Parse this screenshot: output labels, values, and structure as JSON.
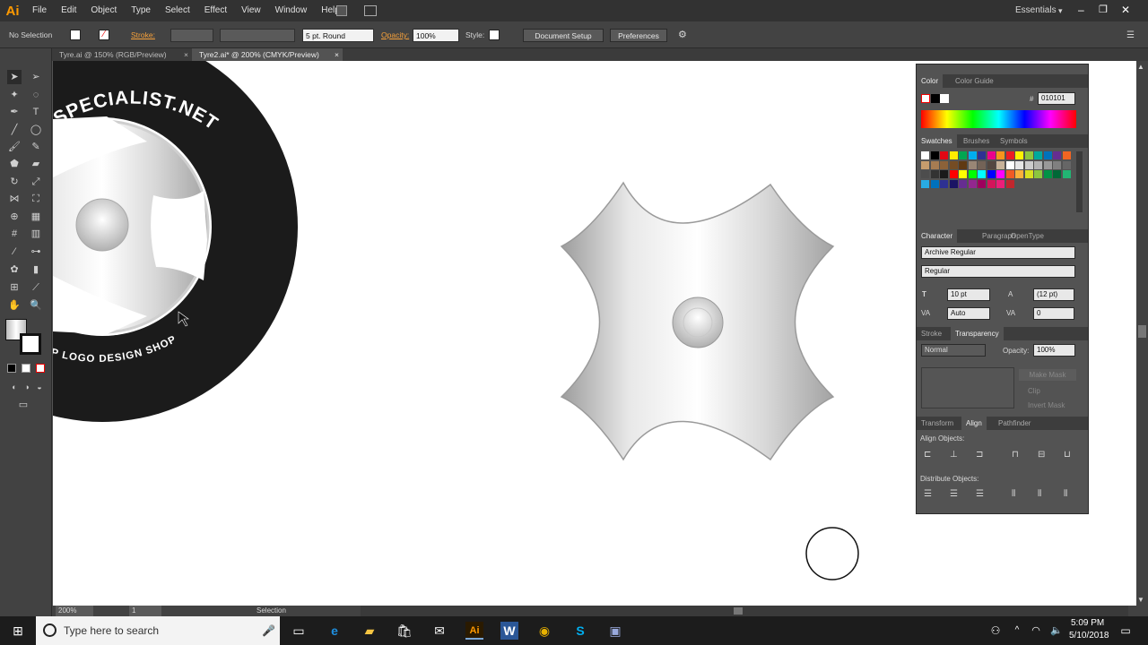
{
  "app": {
    "logo": "Ai"
  },
  "menu": [
    "File",
    "Edit",
    "Object",
    "Type",
    "Select",
    "Effect",
    "View",
    "Window",
    "Help"
  ],
  "workspace": "Essentials",
  "control": {
    "selection": "No Selection",
    "stroke_label": "Stroke:",
    "brush": "5 pt. Round",
    "opacity_label": "Opacity:",
    "opacity": "100%",
    "style_label": "Style:",
    "document_setup": "Document Setup",
    "preferences": "Preferences"
  },
  "tabs": [
    {
      "label": "Tyre.ai @ 150% (RGB/Preview)"
    },
    {
      "label": "Tyre2.ai* @ 200% (CMYK/Preview)"
    }
  ],
  "artwork": {
    "top_text": "SPECIALIST.NET",
    "bottom_text": "OP LOGO DESIGN SHOP"
  },
  "color_panel": {
    "tabs": [
      "Color",
      "Color Guide"
    ],
    "hex": "010101"
  },
  "swatches_panel": {
    "tabs": [
      "Swatches",
      "Brushes",
      "Symbols"
    ]
  },
  "swatch_colors": [
    "#ffffff",
    "#000000",
    "#e30613",
    "#ffed00",
    "#00a651",
    "#00aeef",
    "#2e3192",
    "#ec008c",
    "#f7941d",
    "#ed1c24",
    "#fff200",
    "#8dc63f",
    "#00a99d",
    "#0072bc",
    "#662d91",
    "#f26522",
    "#c69c6d",
    "#a67c52",
    "#8c6239",
    "#754c24",
    "#603913",
    "#998675",
    "#736357",
    "#534741",
    "#c7b299",
    "#ffffff",
    "#e6e6e6",
    "#cccccc",
    "#b3b3b3",
    "#999999",
    "#808080",
    "#666666",
    "#4d4d4d",
    "#333333",
    "#1a1a1a",
    "#ff0000",
    "#ffff00",
    "#00ff00",
    "#00ffff",
    "#0000ff",
    "#ff00ff",
    "#f15a24",
    "#fbb03b",
    "#d9e021",
    "#8cc63f",
    "#009245",
    "#006837",
    "#22b573",
    "#29abe2",
    "#0071bc",
    "#2e3192",
    "#1b1464",
    "#662d91",
    "#93278f",
    "#9e005d",
    "#d4145a",
    "#ed1e79",
    "#c1272d"
  ],
  "character_panel": {
    "tabs": [
      "Character",
      "Paragraph",
      "OpenType"
    ],
    "font": "Archive Regular",
    "style": "Regular",
    "size": "10 pt",
    "leading": "(12 pt)",
    "kerning": "Auto",
    "tracking": "0"
  },
  "transparency_panel": {
    "tabs": [
      "Stroke",
      "Transparency"
    ],
    "mode": "Normal",
    "opacity_label": "Opacity:",
    "opacity": "100%",
    "make_mask": "Make Mask",
    "clip": "Clip",
    "invert_mask": "Invert Mask"
  },
  "align_panel": {
    "tabs": [
      "Transform",
      "Align",
      "Pathfinder"
    ],
    "align_objects": "Align Objects:",
    "distribute_objects": "Distribute Objects:"
  },
  "status": {
    "zoom": "200%",
    "page": "1",
    "tool": "Selection"
  },
  "taskbar": {
    "search_placeholder": "Type here to search",
    "time": "5:09 PM",
    "date": "5/10/2018"
  }
}
